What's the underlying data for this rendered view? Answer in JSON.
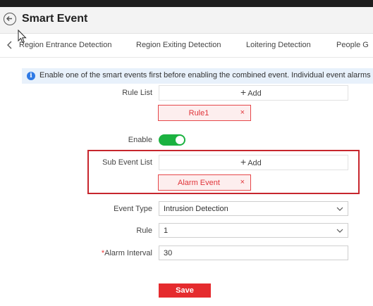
{
  "header": {
    "title": "Smart Event"
  },
  "tabs": [
    {
      "label": "Region Entrance Detection"
    },
    {
      "label": "Region Exiting Detection"
    },
    {
      "label": "Loitering Detection"
    },
    {
      "label": "People G"
    }
  ],
  "notice": {
    "text": "Enable one of the smart events first before enabling the combined event. Individual event alarms"
  },
  "rule_list": {
    "label": "Rule List",
    "add_label": "Add",
    "items": [
      {
        "label": "Rule1",
        "remove": "×"
      }
    ]
  },
  "enable": {
    "label": "Enable",
    "state": "on"
  },
  "sub_event_list": {
    "label": "Sub Event List",
    "add_label": "Add",
    "items": [
      {
        "label": "Alarm Event",
        "remove": "×"
      }
    ]
  },
  "event_type": {
    "label": "Event Type",
    "value": "Intrusion Detection"
  },
  "rule": {
    "label": "Rule",
    "value": "1"
  },
  "alarm_interval": {
    "required_mark": "*",
    "label": "Alarm Interval",
    "value": "30"
  },
  "save_label": "Save",
  "colors": {
    "accent_red": "#e52b2e",
    "toggle_on": "#1bb240",
    "info_blue": "#2f7ae5",
    "highlight_border": "#c7262d"
  }
}
